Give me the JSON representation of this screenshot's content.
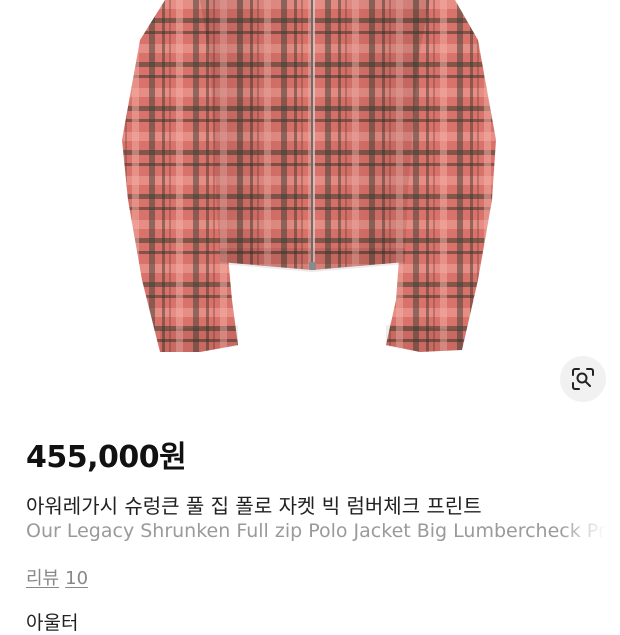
{
  "product": {
    "price": "455,000원",
    "title_ko": "아워레가시 슈렁큰 풀 집 폴로 자켓 빅 럼버체크 프린트",
    "title_en": "Our Legacy Shrunken Full zip Polo Jacket Big Lumbercheck Pr",
    "image_icon": "lens-search-icon"
  },
  "reviews": {
    "label": "리뷰",
    "count": "10"
  },
  "next_section": {
    "label": "아울터"
  },
  "colors": {
    "plaid_base": "#d9726a",
    "plaid_dark": "#3c3f33",
    "plaid_light": "#f0a49a"
  }
}
